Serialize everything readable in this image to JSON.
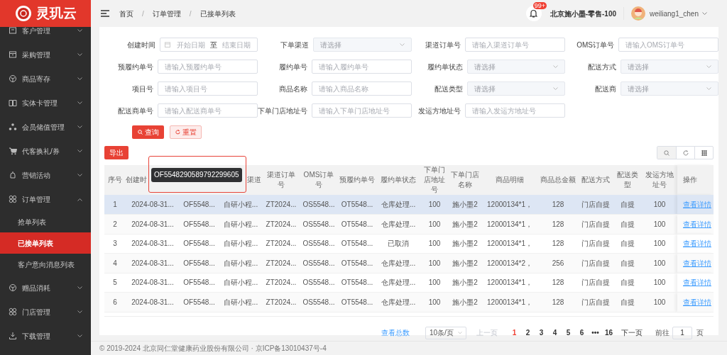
{
  "logo": {
    "text": "灵玑云"
  },
  "sidebar": {
    "items": [
      {
        "label": "客户管理",
        "expanded": false
      },
      {
        "label": "采购管理",
        "expanded": false
      },
      {
        "label": "商品寄存",
        "expanded": false
      },
      {
        "label": "实体卡管理",
        "expanded": false
      },
      {
        "label": "会员储值管理",
        "expanded": false
      },
      {
        "label": "代客换礼/券",
        "expanded": false
      },
      {
        "label": "营销活动",
        "expanded": false
      },
      {
        "label": "订单管理",
        "expanded": true,
        "children": [
          {
            "label": "抢单列表",
            "selected": false
          },
          {
            "label": "已接单列表",
            "selected": true
          },
          {
            "label": "客户意向消息列表",
            "selected": false
          }
        ]
      },
      {
        "label": "赠品消耗",
        "expanded": false
      },
      {
        "label": "门店管理",
        "expanded": false
      },
      {
        "label": "下载管理",
        "expanded": false
      }
    ]
  },
  "breadcrumb": [
    "首页",
    "订单管理",
    "已接单列表"
  ],
  "breadcrumb_separator": "/",
  "header": {
    "badge": "99+",
    "store": "北京施小墨-零售-100",
    "user": "weiliang1_chen"
  },
  "filters": [
    {
      "label": "创建时间",
      "kind": "date_range",
      "start_placeholder": "开始日期",
      "separator": "至",
      "end_placeholder": "结束日期"
    },
    {
      "label": "下单渠道",
      "kind": "select",
      "placeholder": "请选择"
    },
    {
      "label": "渠道订单号",
      "kind": "input",
      "placeholder": "请输入渠道订单号"
    },
    {
      "label": "OMS订单号",
      "kind": "input",
      "placeholder": "请输入OMS订单号"
    },
    {
      "label": "预履约单号",
      "kind": "input",
      "placeholder": "请输入预履约单号"
    },
    {
      "label": "履约单号",
      "kind": "input",
      "placeholder": "请输入履约单号"
    },
    {
      "label": "履约单状态",
      "kind": "select",
      "placeholder": "请选择"
    },
    {
      "label": "配送方式",
      "kind": "select",
      "placeholder": "请选择"
    },
    {
      "label": "项目号",
      "kind": "input",
      "placeholder": "请输入项目号"
    },
    {
      "label": "商品名称",
      "kind": "input",
      "placeholder": "请输入商品名称"
    },
    {
      "label": "配送类型",
      "kind": "select",
      "placeholder": "请选择"
    },
    {
      "label": "配送商",
      "kind": "select",
      "placeholder": "请选择"
    },
    {
      "label": "配送商单号",
      "kind": "input",
      "placeholder": "请输入配送商单号"
    },
    {
      "label": "下单门店地址号",
      "kind": "input",
      "placeholder": "请输入下单门店地址号"
    },
    {
      "label": "发运方地址号",
      "kind": "input",
      "placeholder": "请输入发运方地址号"
    }
  ],
  "search_button": "查询",
  "reset_button": "重置",
  "export_button": "导出",
  "table": {
    "columns": [
      "序号",
      "创建时",
      "",
      "渠道",
      "渠道订单号",
      "OMS订单号",
      "预履约单号",
      "履约单状态",
      "下单门店地址号",
      "下单门店名称",
      "商品明细",
      "商品总金额",
      "配送方式",
      "配送类型",
      "发运方地址号",
      "操作"
    ],
    "rows": [
      {
        "highlighted": true,
        "cells": [
          "1",
          "2024-08-31...",
          "OF5548...",
          "自研小程...",
          "ZT2024...",
          "OS5548...",
          "OT5548...",
          "仓库处理...",
          "100",
          "施小墨2",
          "12000134*1，",
          "128",
          "门店自提",
          "自提",
          "100"
        ],
        "action": "查看详情"
      },
      {
        "highlighted": false,
        "cells": [
          "2",
          "2024-08-31...",
          "OF5548...",
          "自研小程...",
          "ZT2024...",
          "OS5548...",
          "OT5548...",
          "仓库处理...",
          "100",
          "施小墨2",
          "12000134*1，",
          "128",
          "门店自提",
          "自提",
          "100"
        ],
        "action": "查看详情"
      },
      {
        "highlighted": false,
        "cells": [
          "3",
          "2024-08-31...",
          "OF5548...",
          "自研小程...",
          "ZT2024...",
          "OS5548...",
          "OT5548...",
          "已取消",
          "100",
          "施小墨2",
          "12000134*1，",
          "128",
          "门店自提",
          "自提",
          "100"
        ],
        "action": "查看详情"
      },
      {
        "highlighted": false,
        "cells": [
          "4",
          "2024-08-31...",
          "OF5548...",
          "自研小程...",
          "ZT2024...",
          "OS5548...",
          "OT5548...",
          "仓库处理...",
          "100",
          "施小墨2",
          "12000134*2，",
          "256",
          "门店自提",
          "自提",
          "100"
        ],
        "action": "查看详情"
      },
      {
        "highlighted": false,
        "cells": [
          "5",
          "2024-08-31...",
          "OF5548...",
          "自研小程...",
          "ZT2024...",
          "OS5548...",
          "OT5548...",
          "仓库处理...",
          "100",
          "施小墨2",
          "12000134*1，",
          "128",
          "门店自提",
          "自提",
          "100"
        ],
        "action": "查看详情"
      },
      {
        "highlighted": false,
        "cells": [
          "6",
          "2024-08-31...",
          "OF5548...",
          "自研小程...",
          "ZT2024...",
          "OS5548...",
          "OT5548...",
          "仓库处理...",
          "100",
          "施小墨2",
          "12000134*1，",
          "128",
          "门店自提",
          "自提",
          "100"
        ],
        "action": "查看详情"
      }
    ]
  },
  "tooltip": {
    "text": "OF5548290589792299605"
  },
  "pagination": {
    "total_link": "查看总数",
    "page_size": "10条/页",
    "prev": "上一页",
    "prev_disabled": true,
    "pages": [
      {
        "label": "1",
        "selected": true
      },
      {
        "label": "2",
        "selected": false
      },
      {
        "label": "3",
        "selected": false
      },
      {
        "label": "4",
        "selected": false
      },
      {
        "label": "5",
        "selected": false
      },
      {
        "label": "6",
        "selected": false
      },
      {
        "label": "•••",
        "selected": false
      },
      {
        "label": "16",
        "selected": false
      }
    ],
    "next": "下一页",
    "goto_label": "前往",
    "goto_value": "1",
    "goto_suffix": "页"
  },
  "footer": "© 2019-2024 北京同仁堂健康药业股份有限公司 · 京ICP备13010437号-4"
}
